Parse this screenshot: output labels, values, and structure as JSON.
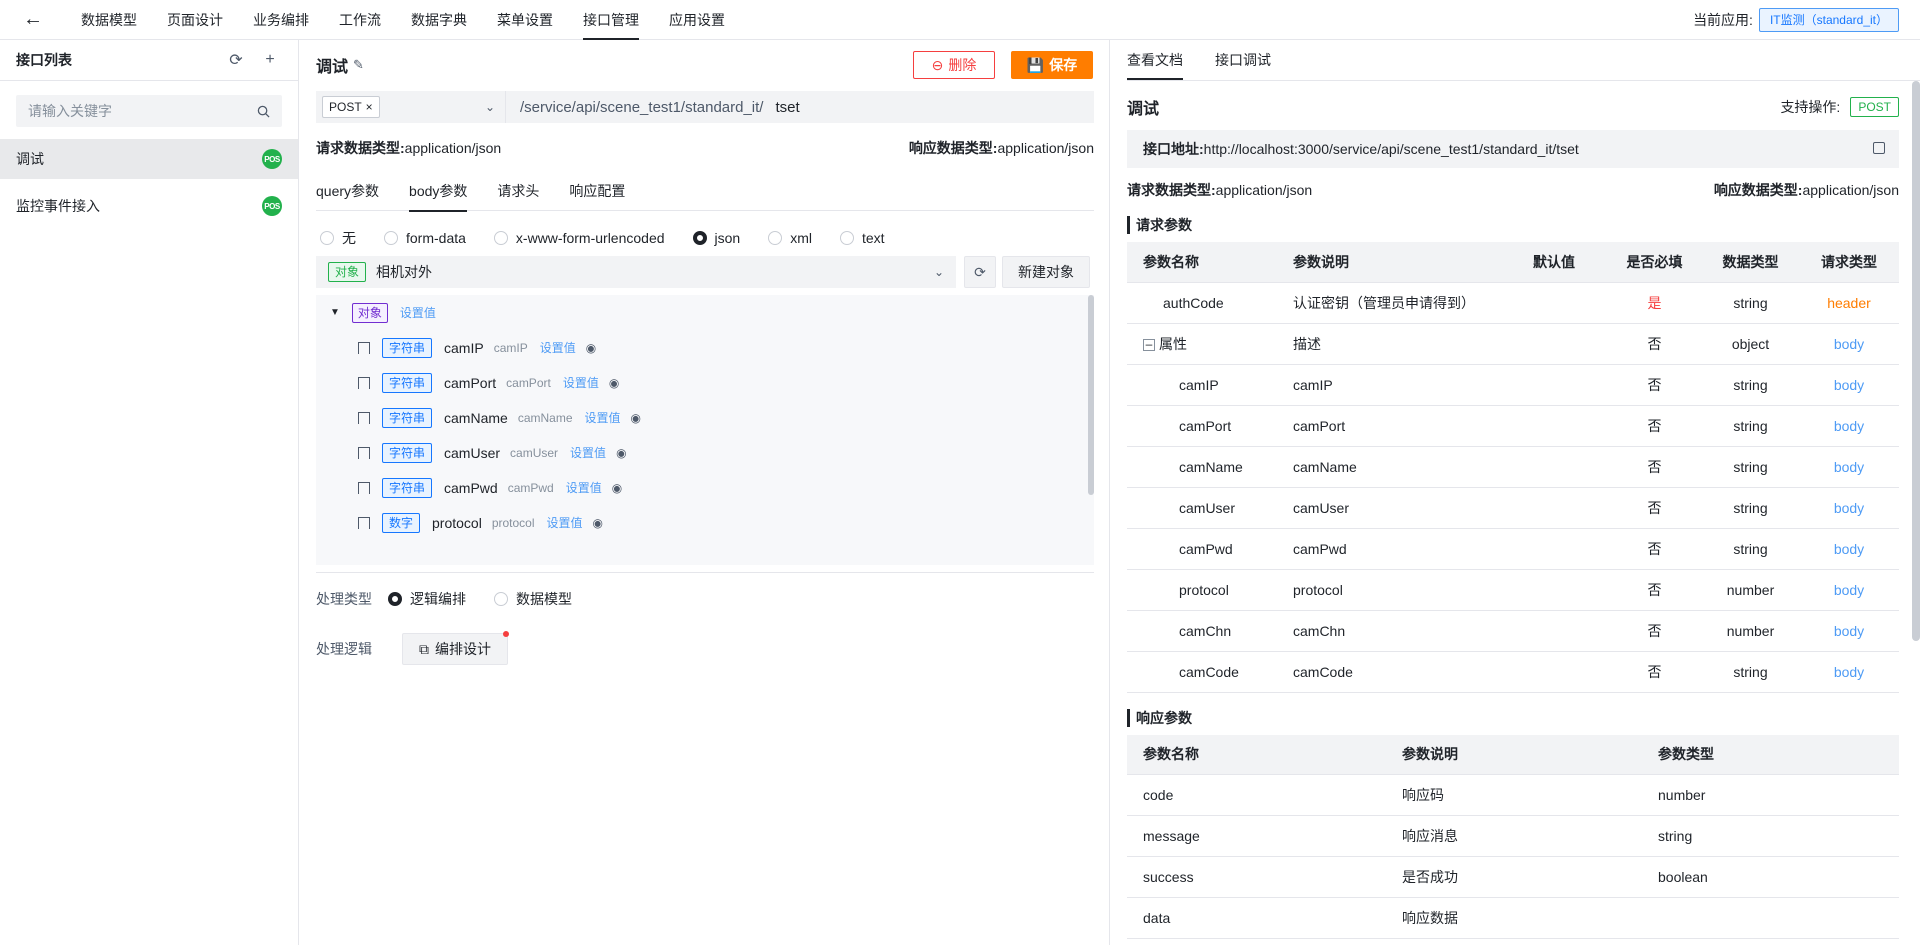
{
  "nav": {
    "back_icon": "arrow-left-icon",
    "tabs": [
      "数据模型",
      "页面设计",
      "业务编排",
      "工作流",
      "数据字典",
      "菜单设置",
      "接口管理",
      "应用设置"
    ],
    "current_app_label": "当前应用:",
    "current_app": "IT监测（standard_it）"
  },
  "sidebar": {
    "title": "接口列表",
    "search_placeholder": "请输入关键字",
    "items": [
      {
        "label": "调试",
        "badge": "POS"
      },
      {
        "label": "监控事件接入",
        "badge": "POS"
      }
    ]
  },
  "editor": {
    "title": "调试",
    "delete_label": "删除",
    "save_label": "保存",
    "method": "POST",
    "url_prefix": "/service/api/scene_test1/standard_it/",
    "url_value": "tset",
    "req_type_label": "请求数据类型:",
    "req_type": "application/json",
    "resp_type_label": "响应数据类型:",
    "resp_type": "application/json",
    "sub_tabs": [
      "query参数",
      "body参数",
      "请求头",
      "响应配置"
    ],
    "body_types": [
      "无",
      "form-data",
      "x-www-form-urlencoded",
      "json",
      "xml",
      "text"
    ],
    "body_selected": "json",
    "object_tag": "对象",
    "object_name": "相机对外",
    "new_object_label": "新建对象",
    "tree_root_tag": "对象",
    "set_value": "设置值",
    "tree_fields": [
      {
        "tag": "字符串",
        "name": "camIP",
        "desc": "camIP"
      },
      {
        "tag": "字符串",
        "name": "camPort",
        "desc": "camPort"
      },
      {
        "tag": "字符串",
        "name": "camName",
        "desc": "camName"
      },
      {
        "tag": "字符串",
        "name": "camUser",
        "desc": "camUser"
      },
      {
        "tag": "字符串",
        "name": "camPwd",
        "desc": "camPwd"
      },
      {
        "tag": "数字",
        "name": "protocol",
        "desc": "protocol"
      }
    ],
    "proc_type_label": "处理类型",
    "proc_options": [
      "逻辑编排",
      "数据模型"
    ],
    "proc_selected": "逻辑编排",
    "logic_label": "处理逻辑",
    "design_label": "编排设计"
  },
  "doc": {
    "tabs": [
      "查看文档",
      "接口调试"
    ],
    "title": "调试",
    "support_label": "支持操作:",
    "support_method": "POST",
    "addr_label": "接口地址:",
    "addr": "http://localhost:3000/service/api/scene_test1/standard_it/tset",
    "req_type_label": "请求数据类型:",
    "req_type": "application/json",
    "resp_type_label": "响应数据类型:",
    "resp_type": "application/json",
    "req_params_title": "请求参数",
    "req_headers": [
      "参数名称",
      "参数说明",
      "默认值",
      "是否必填",
      "数据类型",
      "请求类型"
    ],
    "req_rows": [
      {
        "name": "authCode",
        "desc": "认证密钥（管理员申请得到）",
        "default": "",
        "required": "是",
        "type": "string",
        "req_type": "header"
      },
      {
        "name": "属性",
        "desc": "描述",
        "default": "",
        "required": "否",
        "type": "object",
        "req_type": "body"
      },
      {
        "name": "camIP",
        "desc": "camIP",
        "default": "",
        "required": "否",
        "type": "string",
        "req_type": "body"
      },
      {
        "name": "camPort",
        "desc": "camPort",
        "default": "",
        "required": "否",
        "type": "string",
        "req_type": "body"
      },
      {
        "name": "camName",
        "desc": "camName",
        "default": "",
        "required": "否",
        "type": "string",
        "req_type": "body"
      },
      {
        "name": "camUser",
        "desc": "camUser",
        "default": "",
        "required": "否",
        "type": "string",
        "req_type": "body"
      },
      {
        "name": "camPwd",
        "desc": "camPwd",
        "default": "",
        "required": "否",
        "type": "string",
        "req_type": "body"
      },
      {
        "name": "protocol",
        "desc": "protocol",
        "default": "",
        "required": "否",
        "type": "number",
        "req_type": "body"
      },
      {
        "name": "camChn",
        "desc": "camChn",
        "default": "",
        "required": "否",
        "type": "number",
        "req_type": "body"
      },
      {
        "name": "camCode",
        "desc": "camCode",
        "default": "",
        "required": "否",
        "type": "string",
        "req_type": "body"
      }
    ],
    "resp_params_title": "响应参数",
    "resp_headers": [
      "参数名称",
      "参数说明",
      "参数类型"
    ],
    "resp_rows": [
      {
        "name": "code",
        "desc": "响应码",
        "type": "number"
      },
      {
        "name": "message",
        "desc": "响应消息",
        "type": "string"
      },
      {
        "name": "success",
        "desc": "是否成功",
        "type": "boolean"
      },
      {
        "name": "data",
        "desc": "响应数据",
        "type": ""
      }
    ]
  }
}
